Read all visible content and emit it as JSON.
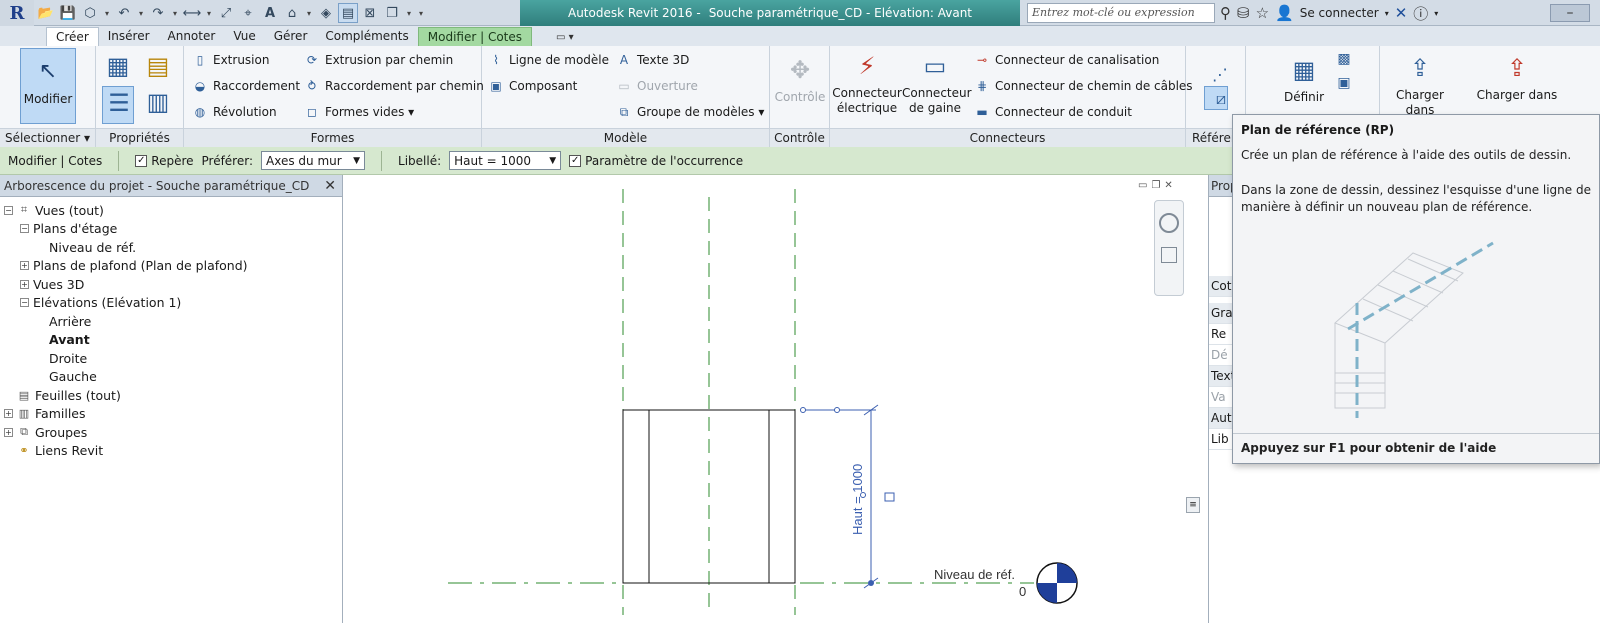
{
  "titlebar": {
    "app_name": "Autodesk Revit 2016 -",
    "doc_title": "Souche paramétrique_CD - Elévation: Avant",
    "search_placeholder": "Entrez mot-clé ou expression",
    "signin_label": "Se connecter"
  },
  "tabs": [
    {
      "label": "Créer",
      "active": true
    },
    {
      "label": "Insérer"
    },
    {
      "label": "Annoter"
    },
    {
      "label": "Vue"
    },
    {
      "label": "Gérer"
    },
    {
      "label": "Compléments"
    },
    {
      "label": "Modifier | Cotes",
      "context": true
    }
  ],
  "ribbon": {
    "selection": {
      "modifier_label": "Modifier",
      "panel_title": "Sélectionner ▾"
    },
    "properties": {
      "panel_title": "Propriétés"
    },
    "formes": {
      "panel_title": "Formes",
      "extrusion": "Extrusion",
      "raccordement": "Raccordement",
      "revolution": "Révolution",
      "extrusion_chemin": "Extrusion par chemin",
      "raccordement_chemin": "Raccordement par chemin",
      "formes_vides": "Formes vides ▾"
    },
    "modele": {
      "panel_title": "Modèle",
      "ligne_modele": "Ligne de modèle",
      "composant": "Composant",
      "texte_3d": "Texte 3D",
      "ouverture": "Ouverture",
      "groupe_modeles": "Groupe de modèles ▾"
    },
    "controle": {
      "panel_title": "Contrôle",
      "controle_label": "Contrôle"
    },
    "connecteurs": {
      "panel_title": "Connecteurs",
      "electrique_l1": "Connecteur",
      "electrique_l2": "électrique",
      "gaine_l1": "Connecteur",
      "gaine_l2": "de gaine",
      "canalisation": "Connecteur de canalisation",
      "chemin_cables": "Connecteur de chemin de câbles",
      "conduit": "Connecteur de conduit"
    },
    "reference": {
      "panel_title": "Référen"
    },
    "definir": {
      "label": "Définir"
    },
    "charger": {
      "label_l1": "Charger dans",
      "label2_l1": "Charger dans"
    }
  },
  "optbar": {
    "context": "Modifier | Cotes",
    "repere": "Repère",
    "preferer_label": "Préférer:",
    "preferer_value": "Axes du mur",
    "libelle_label": "Libellé:",
    "libelle_value": "Haut = 1000",
    "parametre": "Paramètre de l'occurrence"
  },
  "browser": {
    "title": "Arborescence du projet - Souche paramétrique_CD",
    "nodes": [
      {
        "label": "Vues (tout)",
        "level": 0,
        "exp": "-",
        "icon": "views-icon"
      },
      {
        "label": "Plans d'étage",
        "level": 1,
        "exp": "-"
      },
      {
        "label": "Niveau de réf.",
        "level": 2
      },
      {
        "label": "Plans de plafond (Plan de plafond)",
        "level": 1,
        "exp": "+"
      },
      {
        "label": "Vues 3D",
        "level": 1,
        "exp": "+"
      },
      {
        "label": "Elévations (Elévation 1)",
        "level": 1,
        "exp": "-"
      },
      {
        "label": "Arrière",
        "level": 2
      },
      {
        "label": "Avant",
        "level": 2,
        "bold": true
      },
      {
        "label": "Droite",
        "level": 2
      },
      {
        "label": "Gauche",
        "level": 2
      },
      {
        "label": "Feuilles (tout)",
        "level": 0,
        "icon": "sheets-icon"
      },
      {
        "label": "Familles",
        "level": 0,
        "exp": "+",
        "icon": "families-icon"
      },
      {
        "label": "Groupes",
        "level": 0,
        "exp": "+",
        "icon": "groups-icon"
      },
      {
        "label": "Liens Revit",
        "level": 0,
        "icon": "links-icon"
      }
    ]
  },
  "drawing": {
    "dimension_label": "Haut = 1000",
    "level_name": "Niveau de réf.",
    "level_elevation": "0"
  },
  "props": {
    "head": "Prop",
    "rows": [
      {
        "text": "Cote",
        "group": true
      },
      {
        "text": "Grap",
        "group": true
      },
      {
        "text": "Re"
      },
      {
        "text": "Dé",
        "dim": true
      },
      {
        "text": "Text",
        "group": true
      },
      {
        "text": "Va",
        "dim": true
      },
      {
        "text": "Autr",
        "group": true
      },
      {
        "text": "Lib"
      }
    ]
  },
  "tooltip": {
    "title": "Plan de référence (RP)",
    "short": "Crée un plan de référence à l'aide des outils de dessin.",
    "long": "Dans la zone de dessin, dessinez l'esquisse d'une ligne de manière à définir un nouveau plan de référence.",
    "footer": "Appuyez sur F1 pour obtenir de l'aide"
  },
  "colors": {
    "context_tab": "#a3d9a1",
    "options_bar": "#d6e8cf",
    "title_accent": "#3a8f8c",
    "ref_plane": "#2e8b2e",
    "dimension": "#3b5fb0"
  }
}
